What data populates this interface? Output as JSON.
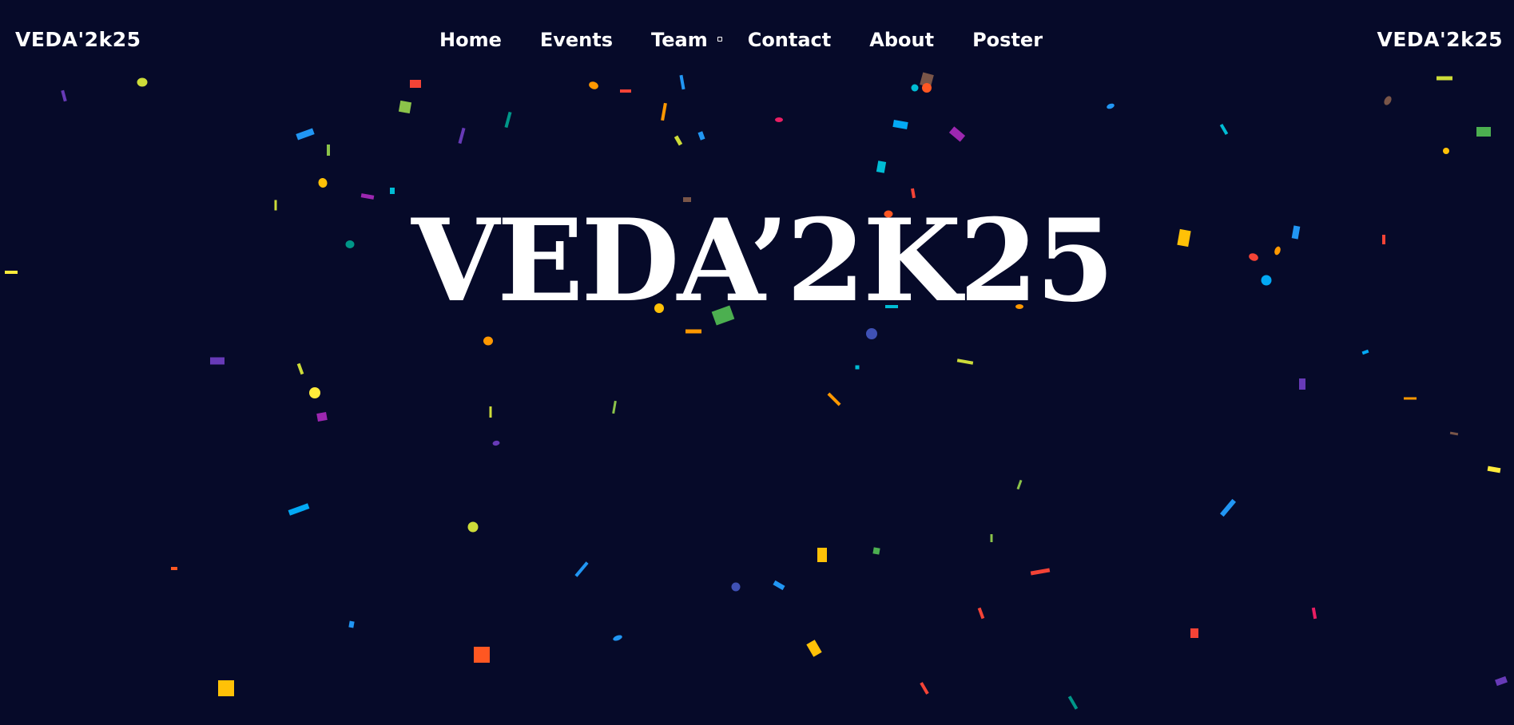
{
  "brand": {
    "left": "VEDA'2k25",
    "right": "VEDA'2k25"
  },
  "nav": {
    "items": [
      {
        "label": "Home",
        "name": "nav-home"
      },
      {
        "label": "Events",
        "name": "nav-events"
      },
      {
        "label": "Team",
        "name": "nav-team"
      },
      {
        "label": "Contact",
        "name": "nav-contact"
      },
      {
        "label": "About",
        "name": "nav-about"
      },
      {
        "label": "Poster",
        "name": "nav-poster"
      }
    ]
  },
  "hero": {
    "title": "VEDA’2K25"
  },
  "colors": {
    "background": "#060a29",
    "text": "#ffffff",
    "confetti": [
      "#cddc39",
      "#f44336",
      "#ffc107",
      "#ff9800",
      "#2196f3",
      "#03a9f4",
      "#00bcd4",
      "#4caf50",
      "#8bc34a",
      "#9c27b0",
      "#673ab7",
      "#3f51b5",
      "#e91e63",
      "#795548",
      "#ff5722",
      "#009688",
      "#ffeb3b"
    ]
  },
  "decoration": {
    "confetti_icon": "confetti-icon"
  }
}
